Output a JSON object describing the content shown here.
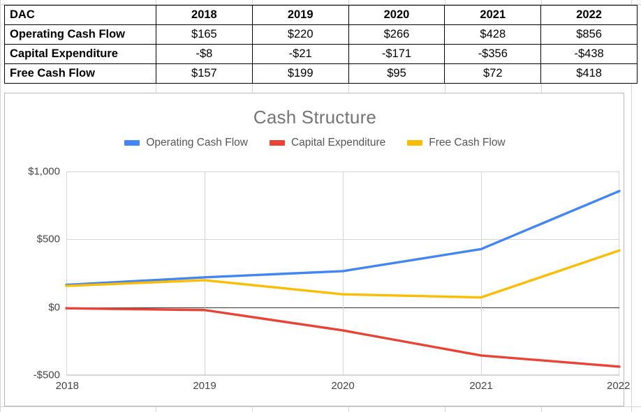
{
  "table": {
    "corner_label": "DAC",
    "year_headers": [
      "2018",
      "2019",
      "2020",
      "2021",
      "2022"
    ],
    "rows": [
      {
        "label": "Operating Cash Flow",
        "values": [
          "$165",
          "$220",
          "$266",
          "$428",
          "$856"
        ]
      },
      {
        "label": "Capital Expenditure",
        "values": [
          "-$8",
          "-$21",
          "-$171",
          "-$356",
          "-$438"
        ]
      },
      {
        "label": "Free Cash Flow",
        "values": [
          "$157",
          "$199",
          "$95",
          "$72",
          "$418"
        ]
      }
    ]
  },
  "chart": {
    "title": "Cash Structure",
    "legend": [
      {
        "label": "Operating Cash Flow",
        "color": "#4285F4"
      },
      {
        "label": "Capital Expenditure",
        "color": "#EA4335"
      },
      {
        "label": "Free Cash Flow",
        "color": "#FBBC04"
      }
    ]
  },
  "chart_data": {
    "type": "line",
    "title": "Cash Structure",
    "xlabel": "",
    "ylabel": "",
    "categories": [
      "2018",
      "2019",
      "2020",
      "2021",
      "2022"
    ],
    "x_tick_labels": [
      "2018",
      "2019",
      "2020",
      "2021",
      "2022"
    ],
    "y_tick_labels": [
      "$1,000",
      "$500",
      "$0",
      "-$500"
    ],
    "y_tick_values": [
      1000,
      500,
      0,
      -500
    ],
    "ylim": [
      -500,
      1000
    ],
    "grid": true,
    "legend_position": "top",
    "zero_line": true,
    "series": [
      {
        "name": "Operating Cash Flow",
        "color": "#4285F4",
        "values": [
          165,
          220,
          266,
          428,
          856
        ]
      },
      {
        "name": "Capital Expenditure",
        "color": "#EA4335",
        "values": [
          -8,
          -21,
          -171,
          -356,
          -438
        ]
      },
      {
        "name": "Free Cash Flow",
        "color": "#FBBC04",
        "values": [
          157,
          199,
          95,
          72,
          418
        ]
      }
    ]
  }
}
